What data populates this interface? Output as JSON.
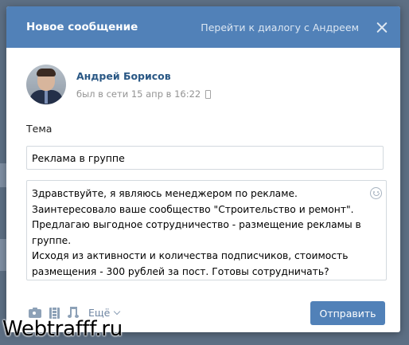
{
  "dialog": {
    "title": "Новое сообщение",
    "go_to_dialog": "Перейти к диалогу с Андреем"
  },
  "user": {
    "name": "Андрей Борисов",
    "status": "был в сети 15 апр в 16:22"
  },
  "form": {
    "subject_label": "Тема",
    "subject_value": "Реклама в группе",
    "message_lines": [
      "Здравствуйте, я являюсь менеджером по рекламе.",
      "Заинтересовало ваше сообщество \"Строительство и ремонт\".",
      "Предлагаю выгодное сотрудничество - размещение рекламы в",
      "группе.",
      "Исходя из активности и количества подписчиков, стоимость",
      "размещения - 300 рублей за пост. Готовы сотрудничать?"
    ]
  },
  "toolbar": {
    "more_label": "Ещё",
    "send_label": "Отправить"
  },
  "watermark": "Webtrafff.ru",
  "colors": {
    "header": "#5181b8",
    "link": "#2a5885",
    "button": "#5181b8"
  }
}
